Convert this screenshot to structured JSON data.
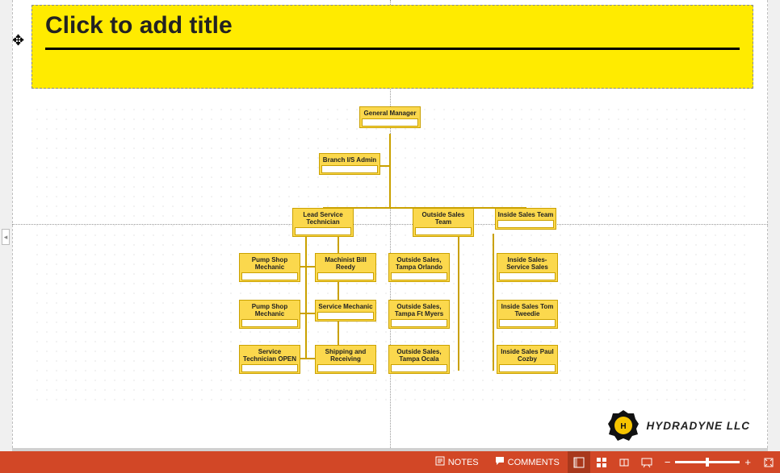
{
  "title_placeholder": "Click to add title",
  "company": {
    "name": "HYDRADYNE LLC"
  },
  "statusbar": {
    "notes": "NOTES",
    "comments": "COMMENTS"
  },
  "org": {
    "gm": {
      "title": "General Manager",
      "name": ""
    },
    "admin": {
      "title": "Branch I/S Admin",
      "name": ""
    },
    "lead": {
      "title": "Lead Service Technician",
      "name": ""
    },
    "out_team": {
      "title": "Outside Sales Team",
      "name": ""
    },
    "in_team": {
      "title": "Inside Sales Team",
      "name": ""
    },
    "psm1": {
      "title": "Pump Shop Mechanic",
      "name": ""
    },
    "psm2": {
      "title": "Pump Shop Mechanic",
      "name": ""
    },
    "stech": {
      "title": "Service Technician OPEN",
      "name": ""
    },
    "mach": {
      "title": "Machinist",
      "name": "Bill Reedy"
    },
    "smech": {
      "title": "Service Mechanic",
      "name": ""
    },
    "ship": {
      "title": "Shipping and Receiving",
      "name": ""
    },
    "os_orl": {
      "title": "Outside Sales, Tampa Orlando",
      "name": ""
    },
    "os_ftm": {
      "title": "Outside Sales, Tampa Ft Myers",
      "name": ""
    },
    "os_oca": {
      "title": "Outside Sales, Tampa Ocala",
      "name": ""
    },
    "is_ss": {
      "title": "Inside Sales- Service Sales",
      "name": ""
    },
    "is_tw": {
      "title": "Inside Sales",
      "name": "Tom Tweedie"
    },
    "is_pc": {
      "title": "Inside Sales",
      "name": "Paul Cozby"
    }
  },
  "chart_data": {
    "type": "org-chart",
    "title": "",
    "root": {
      "role": "General Manager",
      "person": "",
      "children": [
        {
          "role": "Branch I/S Admin",
          "person": "",
          "assistant": true
        },
        {
          "role": "Lead Service Technician",
          "person": "",
          "children": [
            {
              "role": "Pump Shop Mechanic",
              "person": ""
            },
            {
              "role": "Pump Shop Mechanic",
              "person": ""
            },
            {
              "role": "Service Technician OPEN",
              "person": ""
            },
            {
              "role": "Machinist",
              "person": "Bill Reedy"
            },
            {
              "role": "Service Mechanic",
              "person": ""
            },
            {
              "role": "Shipping and Receiving",
              "person": ""
            }
          ]
        },
        {
          "role": "Outside Sales Team",
          "person": "",
          "children": [
            {
              "role": "Outside Sales, Tampa Orlando",
              "person": ""
            },
            {
              "role": "Outside Sales, Tampa Ft Myers",
              "person": ""
            },
            {
              "role": "Outside Sales, Tampa Ocala",
              "person": ""
            }
          ]
        },
        {
          "role": "Inside Sales Team",
          "person": "",
          "children": [
            {
              "role": "Inside Sales- Service Sales",
              "person": ""
            },
            {
              "role": "Inside Sales",
              "person": "Tom Tweedie"
            },
            {
              "role": "Inside Sales",
              "person": "Paul Cozby"
            }
          ]
        }
      ]
    }
  }
}
